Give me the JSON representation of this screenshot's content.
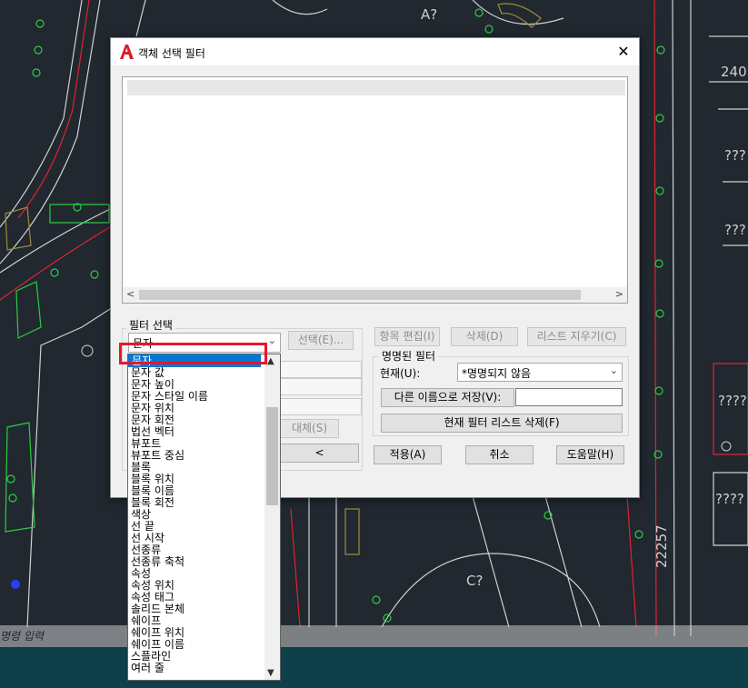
{
  "background": {
    "map_labels": [
      "A?",
      "240",
      "???",
      "???",
      "????",
      "????",
      "C?",
      "22257"
    ],
    "command_line": "명령 입력"
  },
  "dialog": {
    "title": "객체 선택 필터",
    "app_icon": "autocad-a-icon",
    "close_icon": "close-icon",
    "filter_selection": {
      "legend": "필터 선택",
      "combo_value": "문자",
      "select_button": "선택(E)...",
      "substitute_button": "대체(S)",
      "add_button": "<"
    },
    "top_buttons": {
      "edit_item": "항목 편집(I)",
      "delete": "삭제(D)",
      "clear_list": "리스트 지우기(C)"
    },
    "named_filters": {
      "legend": "명명된 필터",
      "current_label": "현재(U):",
      "current_value": "*명명되지 않음",
      "save_as": "다른 이름으로 저장(V):",
      "save_as_value": "",
      "delete_current": "현재 필터 리스트 삭제(F)"
    },
    "bottom_buttons": {
      "apply": "적용(A)",
      "cancel": "취소",
      "help": "도움말(H)"
    }
  },
  "dropdown": {
    "items": [
      "문자",
      "문자 값",
      "문자 높이",
      "문자 스타일 이름",
      "문자 위치",
      "문자 회전",
      "법선 벡터",
      "뷰포트",
      "뷰포트 중심",
      "블록",
      "블록 위치",
      "블록 이름",
      "블록 회전",
      "색상",
      "선 끝",
      "선 시작",
      "선종류",
      "선종류 축척",
      "속성",
      "속성 위치",
      "속성 태그",
      "솔리드 본체",
      "쉐이프",
      "쉐이프 위치",
      "쉐이프 이름",
      "스플라인",
      "여러 줄"
    ],
    "selected_index": 0
  },
  "colors": {
    "cad_background": "#212830",
    "selection": "#0078d7",
    "highlight_box": "#e8162a"
  }
}
